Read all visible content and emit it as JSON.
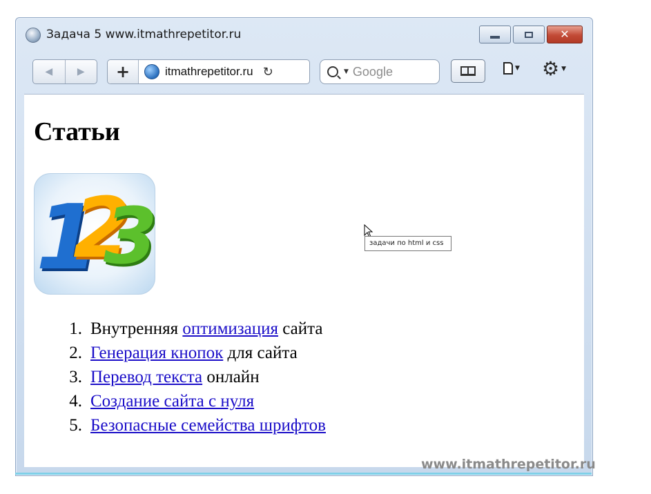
{
  "window": {
    "title": "Задача 5 www.itmathrepetitor.ru"
  },
  "toolbar": {
    "back_glyph": "◀",
    "forward_glyph": "▶",
    "add_glyph": "+",
    "url": "itmathrepetitor.ru",
    "reload_glyph": "↻",
    "search_placeholder": "Google"
  },
  "page": {
    "heading": "Статьи",
    "logo_digits": [
      "1",
      "2",
      "3"
    ],
    "list": [
      {
        "num": "1.",
        "before": "Внутренняя ",
        "link": "оптимизация",
        "after": " сайта"
      },
      {
        "num": "2.",
        "before": "",
        "link": "Генерация кнопок",
        "after": " для сайта"
      },
      {
        "num": "3.",
        "before": "",
        "link": "Перевод текста",
        "after": " онлайн"
      },
      {
        "num": "4.",
        "before": "",
        "link": "Создание сайта с нуля",
        "after": ""
      },
      {
        "num": "5.",
        "before": "",
        "link": "Безопасные семейства шрифтов",
        "after": ""
      }
    ]
  },
  "tooltip": "задачи по html и css",
  "watermark": "www.itmathrepetitor.ru",
  "icons": [
    "safari-icon",
    "minimize-icon",
    "maximize-icon",
    "close-icon",
    "back-icon",
    "forward-icon",
    "add-icon",
    "globe-icon",
    "reload-icon",
    "search-icon",
    "reader-icon",
    "page-icon",
    "gear-icon",
    "cursor-icon"
  ]
}
